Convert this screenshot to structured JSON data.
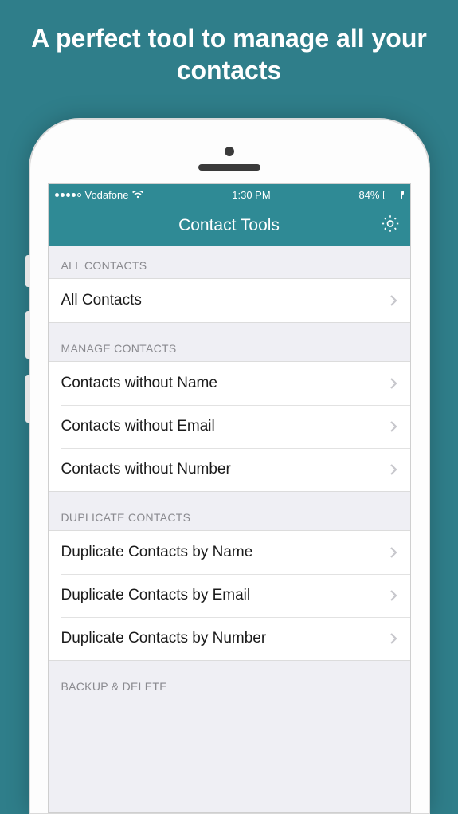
{
  "hero": {
    "title": "A perfect tool to manage all your contacts"
  },
  "status": {
    "carrier": "Vodafone",
    "time": "1:30 PM",
    "battery_pct": "84%"
  },
  "nav": {
    "title": "Contact Tools"
  },
  "sections": [
    {
      "header": "ALL CONTACTS",
      "items": [
        {
          "label": "All Contacts"
        }
      ]
    },
    {
      "header": "MANAGE CONTACTS",
      "items": [
        {
          "label": "Contacts without Name"
        },
        {
          "label": "Contacts without Email"
        },
        {
          "label": "Contacts without Number"
        }
      ]
    },
    {
      "header": "DUPLICATE CONTACTS",
      "items": [
        {
          "label": "Duplicate Contacts by Name"
        },
        {
          "label": "Duplicate Contacts by Email"
        },
        {
          "label": "Duplicate Contacts by Number"
        }
      ]
    },
    {
      "header": "BACKUP & DELETE",
      "items": []
    }
  ]
}
